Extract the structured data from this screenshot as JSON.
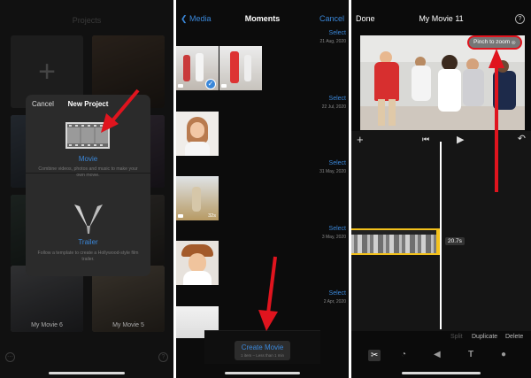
{
  "projects_screen": {
    "title": "Projects",
    "tile_labels": [
      "My Movie 6",
      "My Movie 5"
    ],
    "modal": {
      "cancel_label": "Cancel",
      "title": "New Project",
      "options": [
        {
          "label": "Movie",
          "description": "Combine videos, photos and music to make your own movie.",
          "icon": "film-strip-icon"
        },
        {
          "label": "Trailer",
          "description": "Follow a template to create a Hollywood-style film trailer.",
          "icon": "clapper-icon"
        }
      ]
    }
  },
  "moments_screen": {
    "back_label": "Media",
    "title": "Moments",
    "cancel_label": "Cancel",
    "sections": [
      {
        "select_label": "Select",
        "date": "21 Aug, 2020"
      },
      {
        "select_label": "Select",
        "date": "22 Jul, 2020"
      },
      {
        "select_label": "Select",
        "date": "31 May, 2020"
      },
      {
        "select_label": "Select",
        "date": "3 May, 2020"
      },
      {
        "select_label": "Select",
        "date": "2 Apr, 2020"
      }
    ],
    "clip_duration": "32s",
    "create_button": {
      "label": "Create Movie",
      "subtitle": "1 item – Less than 1 min"
    }
  },
  "editor_screen": {
    "done_label": "Done",
    "title": "My Movie 11",
    "help_icon": "help-icon",
    "pinch_hint": "Pinch to zoom",
    "clip_length": "20.7s",
    "actions": [
      "Split",
      "Duplicate",
      "Delete"
    ],
    "tools": [
      "scissors-icon",
      "speedometer-icon",
      "volume-icon",
      "text-icon",
      "filters-icon"
    ]
  },
  "colors": {
    "accent": "#3a87d9",
    "arrow": "#e0141e",
    "clip_border": "#f3c11c"
  }
}
